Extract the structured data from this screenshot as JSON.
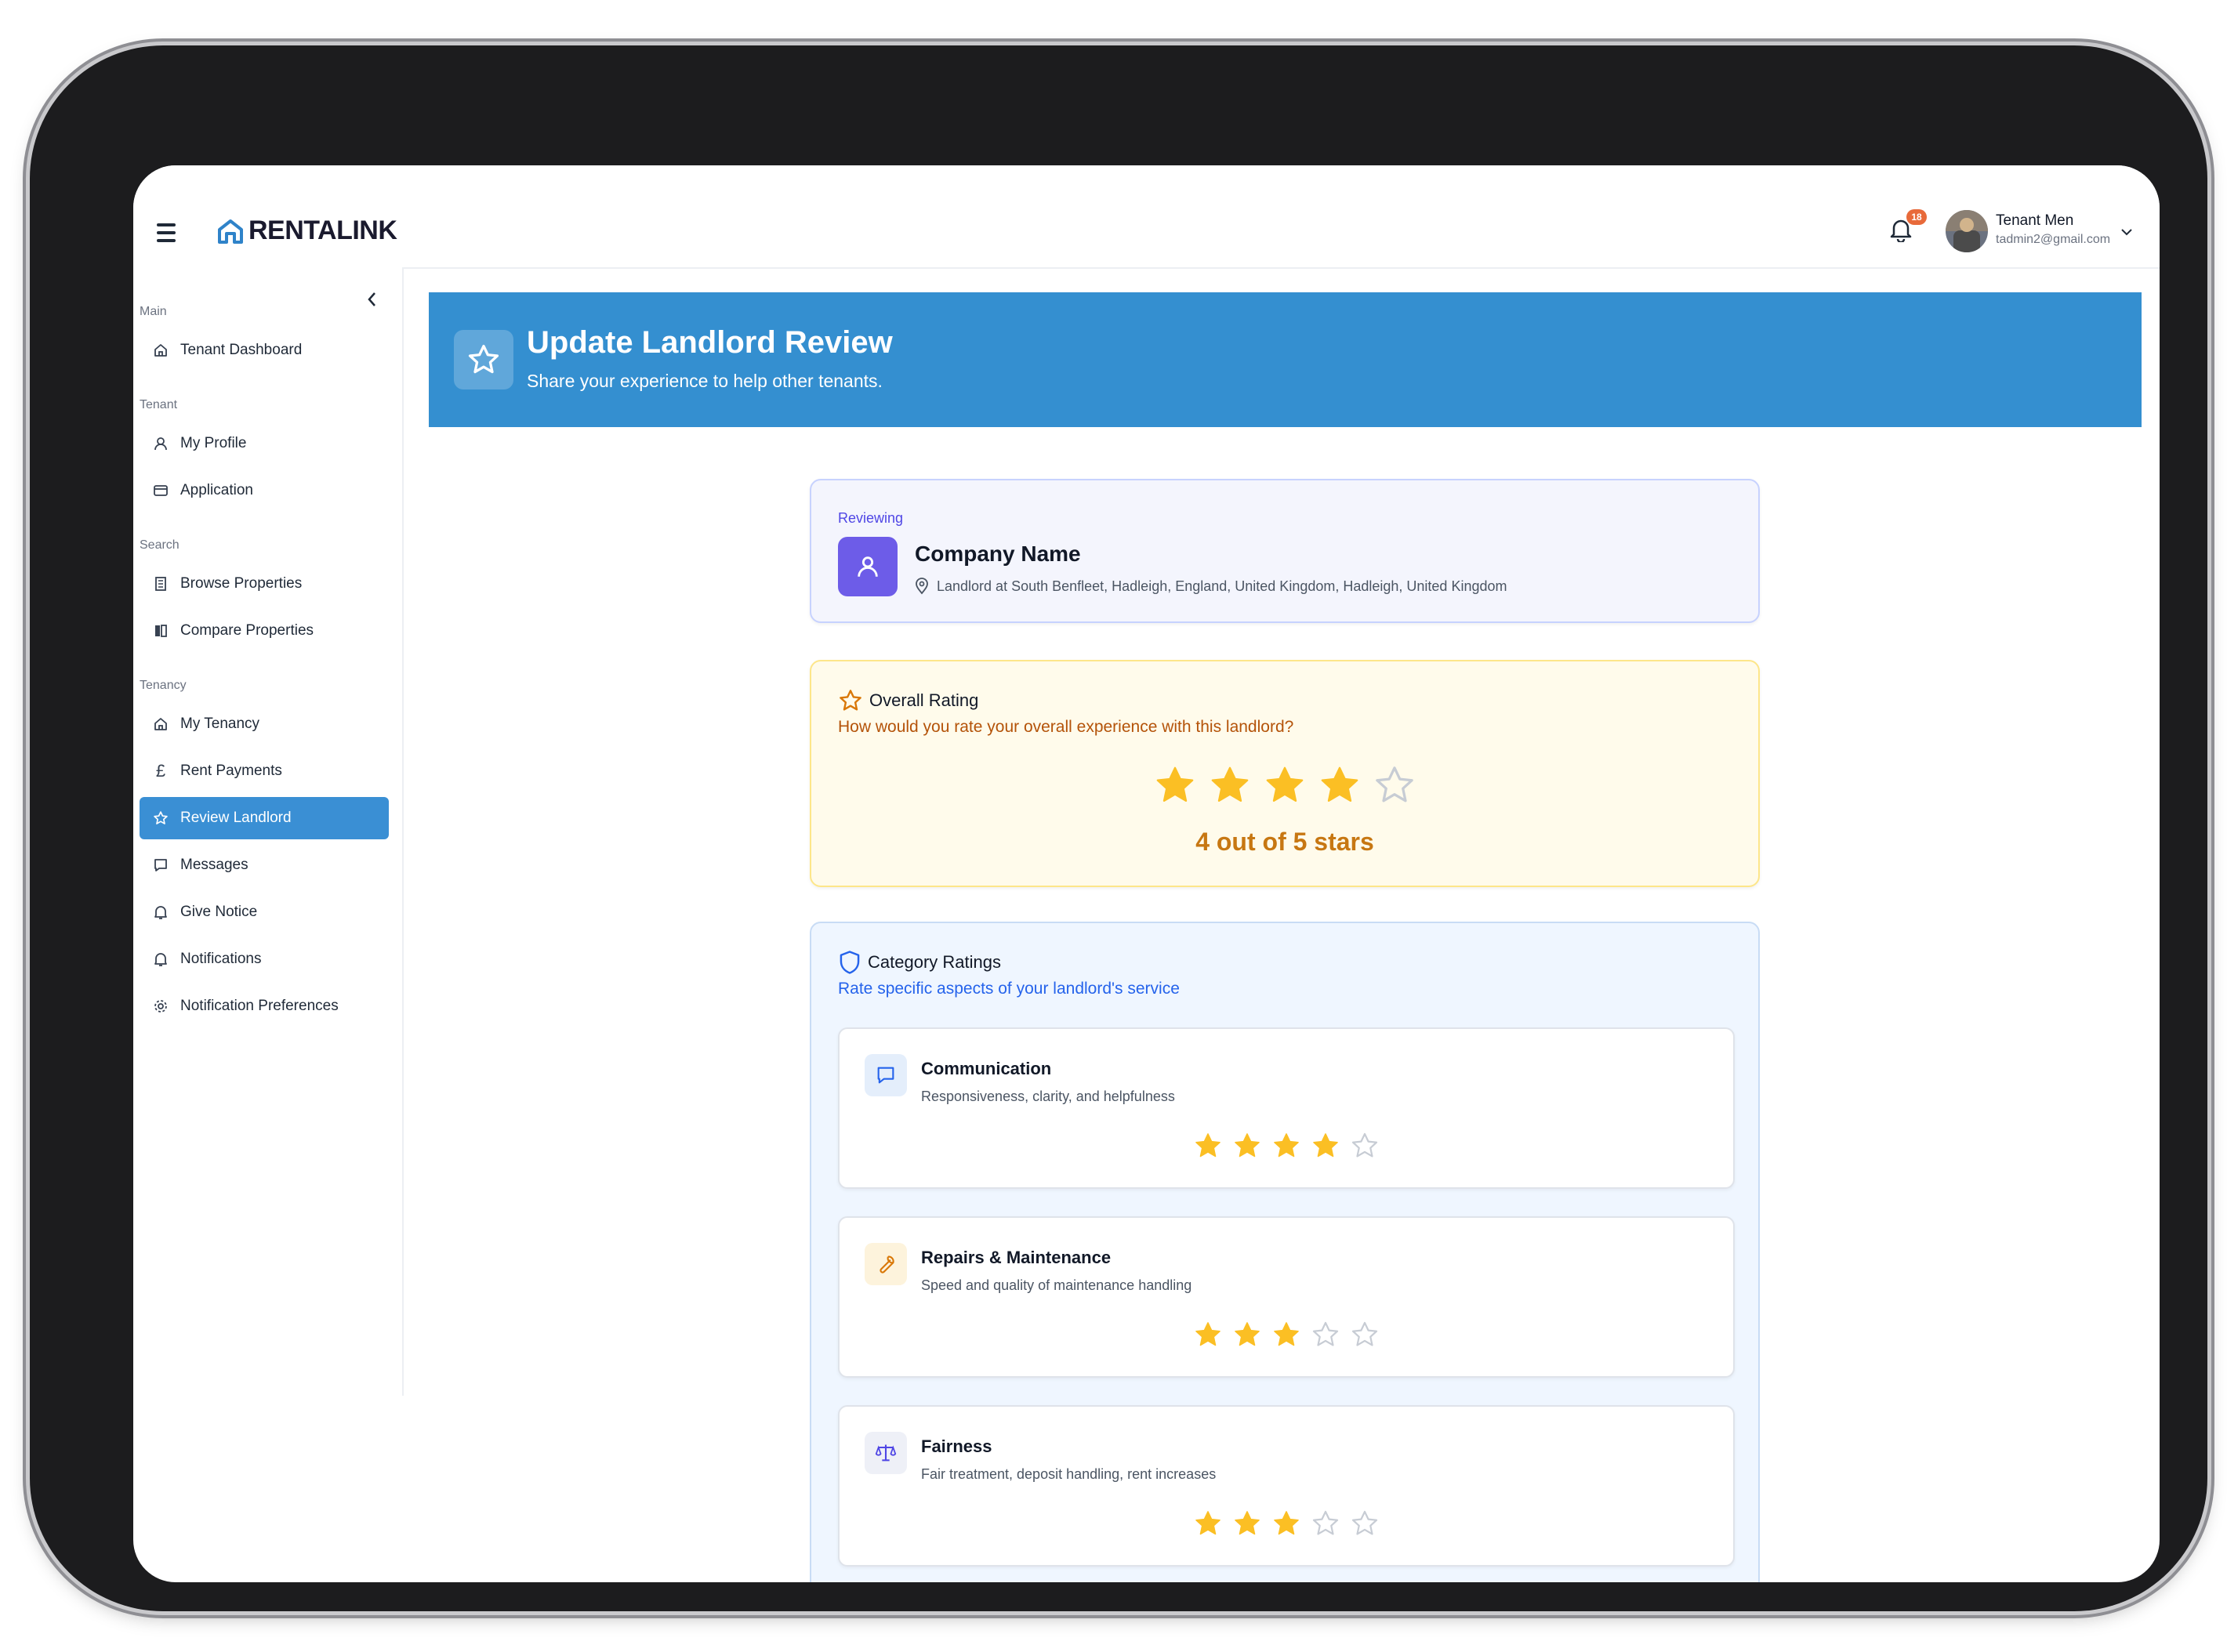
{
  "app": {
    "brand": "RENTALINK"
  },
  "header": {
    "notification_count": "18",
    "user_name": "Tenant Men",
    "user_email": "tadmin2@gmail.com"
  },
  "sidebar": {
    "sections": [
      {
        "label": "Main",
        "items": [
          {
            "label": "Tenant Dashboard",
            "icon": "home-icon"
          }
        ]
      },
      {
        "label": "Tenant",
        "items": [
          {
            "label": "My Profile",
            "icon": "user-icon"
          },
          {
            "label": "Application",
            "icon": "card-icon"
          }
        ]
      },
      {
        "label": "Search",
        "items": [
          {
            "label": "Browse Properties",
            "icon": "building-icon"
          },
          {
            "label": "Compare Properties",
            "icon": "compare-icon"
          }
        ]
      },
      {
        "label": "Tenancy",
        "items": [
          {
            "label": "My Tenancy",
            "icon": "home-icon"
          },
          {
            "label": "Rent Payments",
            "icon": "pound-icon"
          },
          {
            "label": "Review Landlord",
            "icon": "star-icon",
            "active": true
          },
          {
            "label": "Messages",
            "icon": "message-icon"
          },
          {
            "label": "Give Notice",
            "icon": "bell-icon"
          },
          {
            "label": "Notifications",
            "icon": "bell-icon"
          },
          {
            "label": "Notification Preferences",
            "icon": "gear-icon"
          }
        ]
      }
    ]
  },
  "banner": {
    "title": "Update Landlord Review",
    "subtitle": "Share your experience to help other tenants."
  },
  "review_target": {
    "label": "Reviewing",
    "name": "Company Name",
    "location": "Landlord at South Benfleet, Hadleigh, England, United Kingdom, Hadleigh, United Kingdom"
  },
  "overall": {
    "title": "Overall Rating",
    "question": "How would you rate your overall experience with this landlord?",
    "rating": 4,
    "max": 5,
    "summary": "4 out of 5 stars"
  },
  "categories": {
    "title": "Category Ratings",
    "subtitle": "Rate specific aspects of your landlord's service",
    "items": [
      {
        "title": "Communication",
        "description": "Responsiveness, clarity, and helpfulness",
        "rating": 4,
        "icon": "message-icon",
        "icon_bg": "#e4eefb"
      },
      {
        "title": "Repairs & Maintenance",
        "description": "Speed and quality of maintenance handling",
        "rating": 3,
        "icon": "wrench-icon",
        "icon_bg": "#fdf3dc"
      },
      {
        "title": "Fairness",
        "description": "Fair treatment, deposit handling, rent increases",
        "rating": 3,
        "icon": "scale-icon",
        "icon_bg": "#eef0f7"
      }
    ]
  },
  "colors": {
    "primary": "#348fd0",
    "star_filled": "#fbbf24",
    "star_empty": "#c7ccd4",
    "accent_purple": "#6d5ce8"
  }
}
